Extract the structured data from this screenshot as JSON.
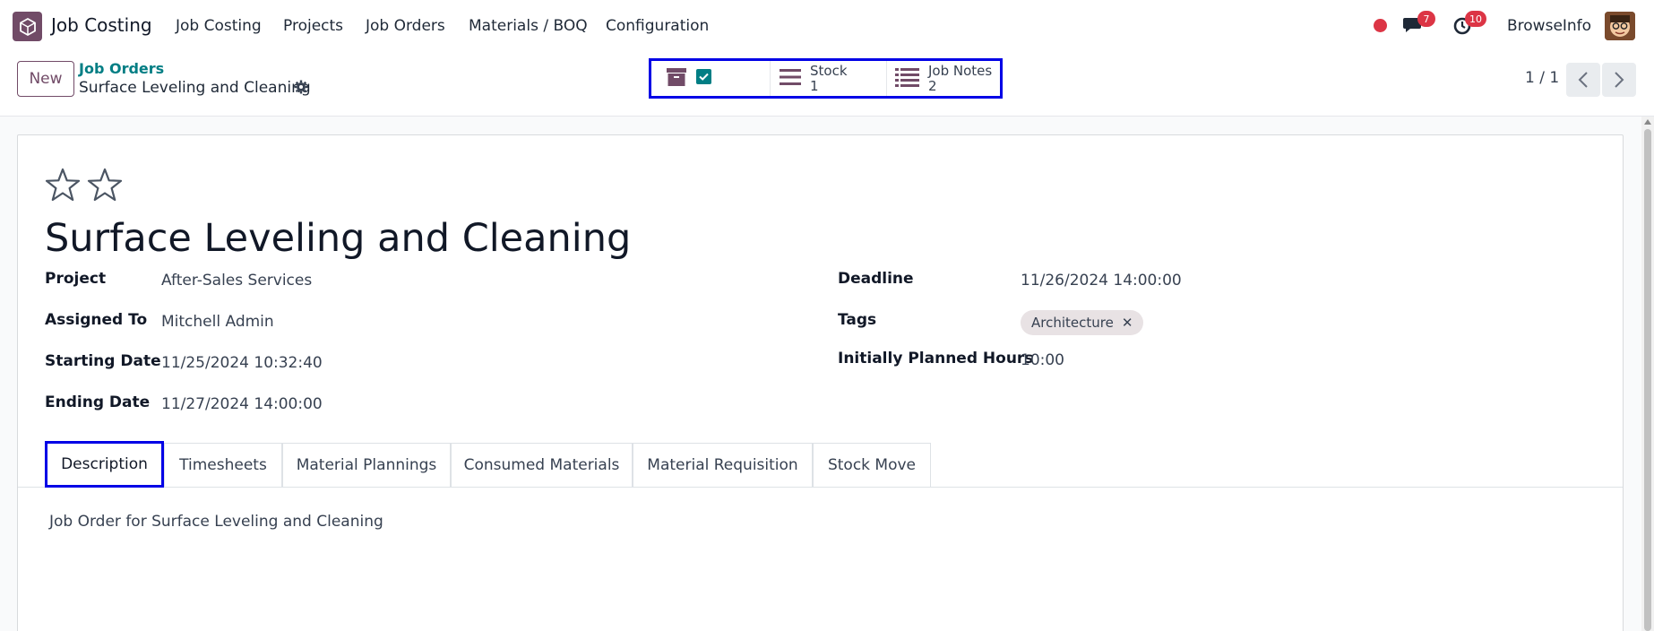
{
  "navbar": {
    "app_name": "Job Costing",
    "menu": [
      "Job Costing",
      "Projects",
      "Job Orders",
      "Materials / BOQ",
      "Configuration"
    ],
    "messages_count": "7",
    "activities_count": "10",
    "user_name": "BrowseInfo"
  },
  "control": {
    "new_label": "New",
    "breadcrumb_parent": "Job Orders",
    "breadcrumb_current": "Surface Leveling and Cleaning",
    "smart_buttons": [
      {
        "label": "Stock",
        "count": "1"
      },
      {
        "label": "Job Notes",
        "count": "2"
      }
    ],
    "pager": "1 / 1"
  },
  "form": {
    "title": "Surface Leveling and Cleaning",
    "fields_left": [
      {
        "label": "Project",
        "value": "After-Sales Services"
      },
      {
        "label": "Assigned To",
        "value": "Mitchell Admin"
      },
      {
        "label": "Starting Date",
        "value": "11/25/2024 10:32:40"
      },
      {
        "label": "Ending Date",
        "value": "11/27/2024 14:00:00"
      }
    ],
    "fields_right": [
      {
        "label": "Deadline",
        "value": "11/26/2024 14:00:00"
      },
      {
        "label": "Tags",
        "value": "Architecture"
      },
      {
        "label": "Initially Planned Hours",
        "value": "10:00"
      }
    ],
    "tabs": [
      "Description",
      "Timesheets",
      "Material Plannings",
      "Consumed Materials",
      "Material Requisition",
      "Stock Move"
    ],
    "description": "Job Order for Surface Leveling and Cleaning"
  },
  "colors": {
    "brand": "#714b67",
    "link": "#017e84",
    "highlight": "#0000e6",
    "badge": "#dc3545"
  },
  "icons": [
    "app-logo-icon",
    "record-dot-icon",
    "chat-icon",
    "clock-icon",
    "gear-icon",
    "archive-icon",
    "checkbox-icon",
    "list-icon",
    "list-bullets-icon",
    "star-icon",
    "chevron-left-icon",
    "chevron-right-icon",
    "close-icon"
  ]
}
